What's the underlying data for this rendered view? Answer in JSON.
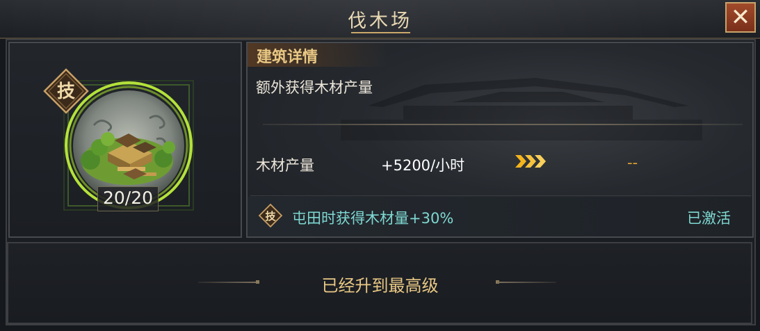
{
  "window": {
    "title": "伐木场",
    "close_glyph": "✕"
  },
  "building": {
    "icon": "lumber-camp-icon",
    "badge_char": "技",
    "level_current": "20",
    "level_separator": "/",
    "level_max": "20"
  },
  "details": {
    "heading": "建筑详情",
    "description": "额外获得木材产量",
    "stat_label": "木材产量",
    "stat_current": "+5200/小时",
    "arrow_glyph": "»»",
    "stat_next": "--"
  },
  "skill": {
    "badge_char": "技",
    "text": "屯田时获得木材量+30%",
    "status": "已激活"
  },
  "footer": {
    "message": "已经升到最高级"
  },
  "colors": {
    "gold_text": "#e9c884",
    "teal_text": "#7ed8d2",
    "close_bg": "#8e3c22",
    "arrow": "#f4b41c",
    "glow_green": "#b4e23a"
  }
}
